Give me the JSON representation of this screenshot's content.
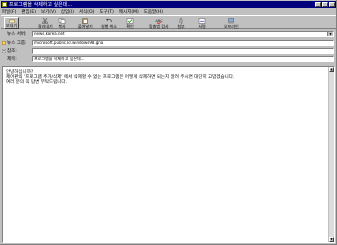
{
  "window": {
    "title": "프로그램을 삭제하고 싶은데..."
  },
  "menu": [
    "파일(F)",
    "편집(E)",
    "보기(V)",
    "삽입(I)",
    "서식(O)",
    "도구(T)",
    "메시지(M)",
    "도움말(H)"
  ],
  "toolbar": {
    "send": "보내기",
    "buttons": [
      "잘라내기",
      "복사",
      "붙여넣기",
      "실행 취소",
      "확인",
      "맞춤법 검사",
      "첨부",
      "서명",
      "오프라인"
    ]
  },
  "headers": {
    "news_server_label": "뉴스 서버:",
    "news_server_value": "news.korea.net",
    "newsgroups_label": "뉴스 그룹:",
    "newsgroups_value": "microsoft.public.kr.windows98.gna",
    "cc_label": "참조:",
    "cc_value": "",
    "subject_label": "제목:",
    "subject_value": "프로그램을 삭제하고 싶은데..."
  },
  "body_lines": [
    "안녕하십니까?",
    "제어판의 '프로그램 추가/삭제' 에서 삭제할  수 없는 프로그램은 어떻게 삭제하면 되는지 알려 주시면 대단히 고맙겠습니다.",
    "여러 분의 꼭 답변 부탁드립니다."
  ],
  "colors": {
    "titlebar": "#00007c",
    "chrome": "#c0c0c0"
  }
}
